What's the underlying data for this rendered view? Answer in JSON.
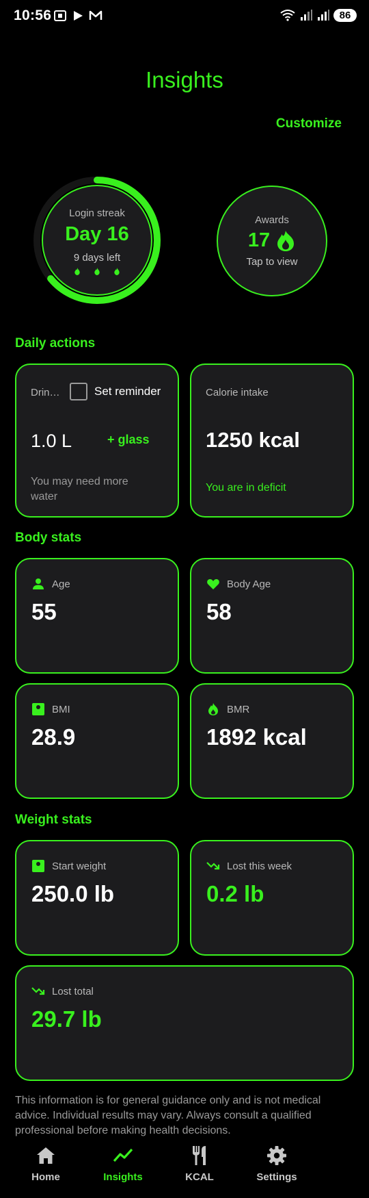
{
  "status_bar": {
    "time": "10:56",
    "battery": "86"
  },
  "header": {
    "title": "Insights",
    "customize_label": "Customize"
  },
  "streak": {
    "label": "Login streak",
    "day": "Day 16",
    "days_left": "9 days left",
    "progress": 0.64
  },
  "awards": {
    "label": "Awards",
    "count": "17",
    "tap_label": "Tap to view"
  },
  "daily_actions": {
    "title": "Daily actions",
    "water": {
      "label": "Drin…",
      "reminder_label": "Set reminder",
      "reminder_checked": false,
      "value": "1.0 L",
      "add_label": "+ glass",
      "hint": "You may need more water"
    },
    "calories": {
      "label": "Calorie intake",
      "value": "1250 kcal",
      "status": "You are in deficit"
    }
  },
  "body_stats": {
    "title": "Body stats",
    "age": {
      "label": "Age",
      "value": "55",
      "icon": "person-icon"
    },
    "body_age": {
      "label": "Body Age",
      "value": "58",
      "icon": "heart-icon"
    },
    "bmi": {
      "label": "BMI",
      "value": "28.9",
      "icon": "scale-icon"
    },
    "bmr": {
      "label": "BMR",
      "value": "1892 kcal",
      "icon": "flame-icon"
    }
  },
  "weight_stats": {
    "title": "Weight stats",
    "start_weight": {
      "label": "Start weight",
      "value": "250.0 lb",
      "icon": "scale-icon"
    },
    "lost_week": {
      "label": "Lost this week",
      "value": "0.2 lb",
      "icon": "trending-down-icon"
    },
    "lost_total": {
      "label": "Lost total",
      "value": "29.7 lb",
      "icon": "trending-down-icon"
    }
  },
  "disclaimer": "This information is for general guidance only and is not medical advice. Individual results may vary. Always consult a qualified professional before making health decisions.",
  "nav": {
    "items": [
      {
        "label": "Home",
        "icon": "home-icon",
        "active": false
      },
      {
        "label": "Insights",
        "icon": "insights-icon",
        "active": true
      },
      {
        "label": "KCAL",
        "icon": "fork-knife-icon",
        "active": false
      },
      {
        "label": "Settings",
        "icon": "gear-icon",
        "active": false
      }
    ]
  },
  "colors": {
    "accent": "#39f01e",
    "background": "#000000",
    "card": "#1c1c1e"
  }
}
